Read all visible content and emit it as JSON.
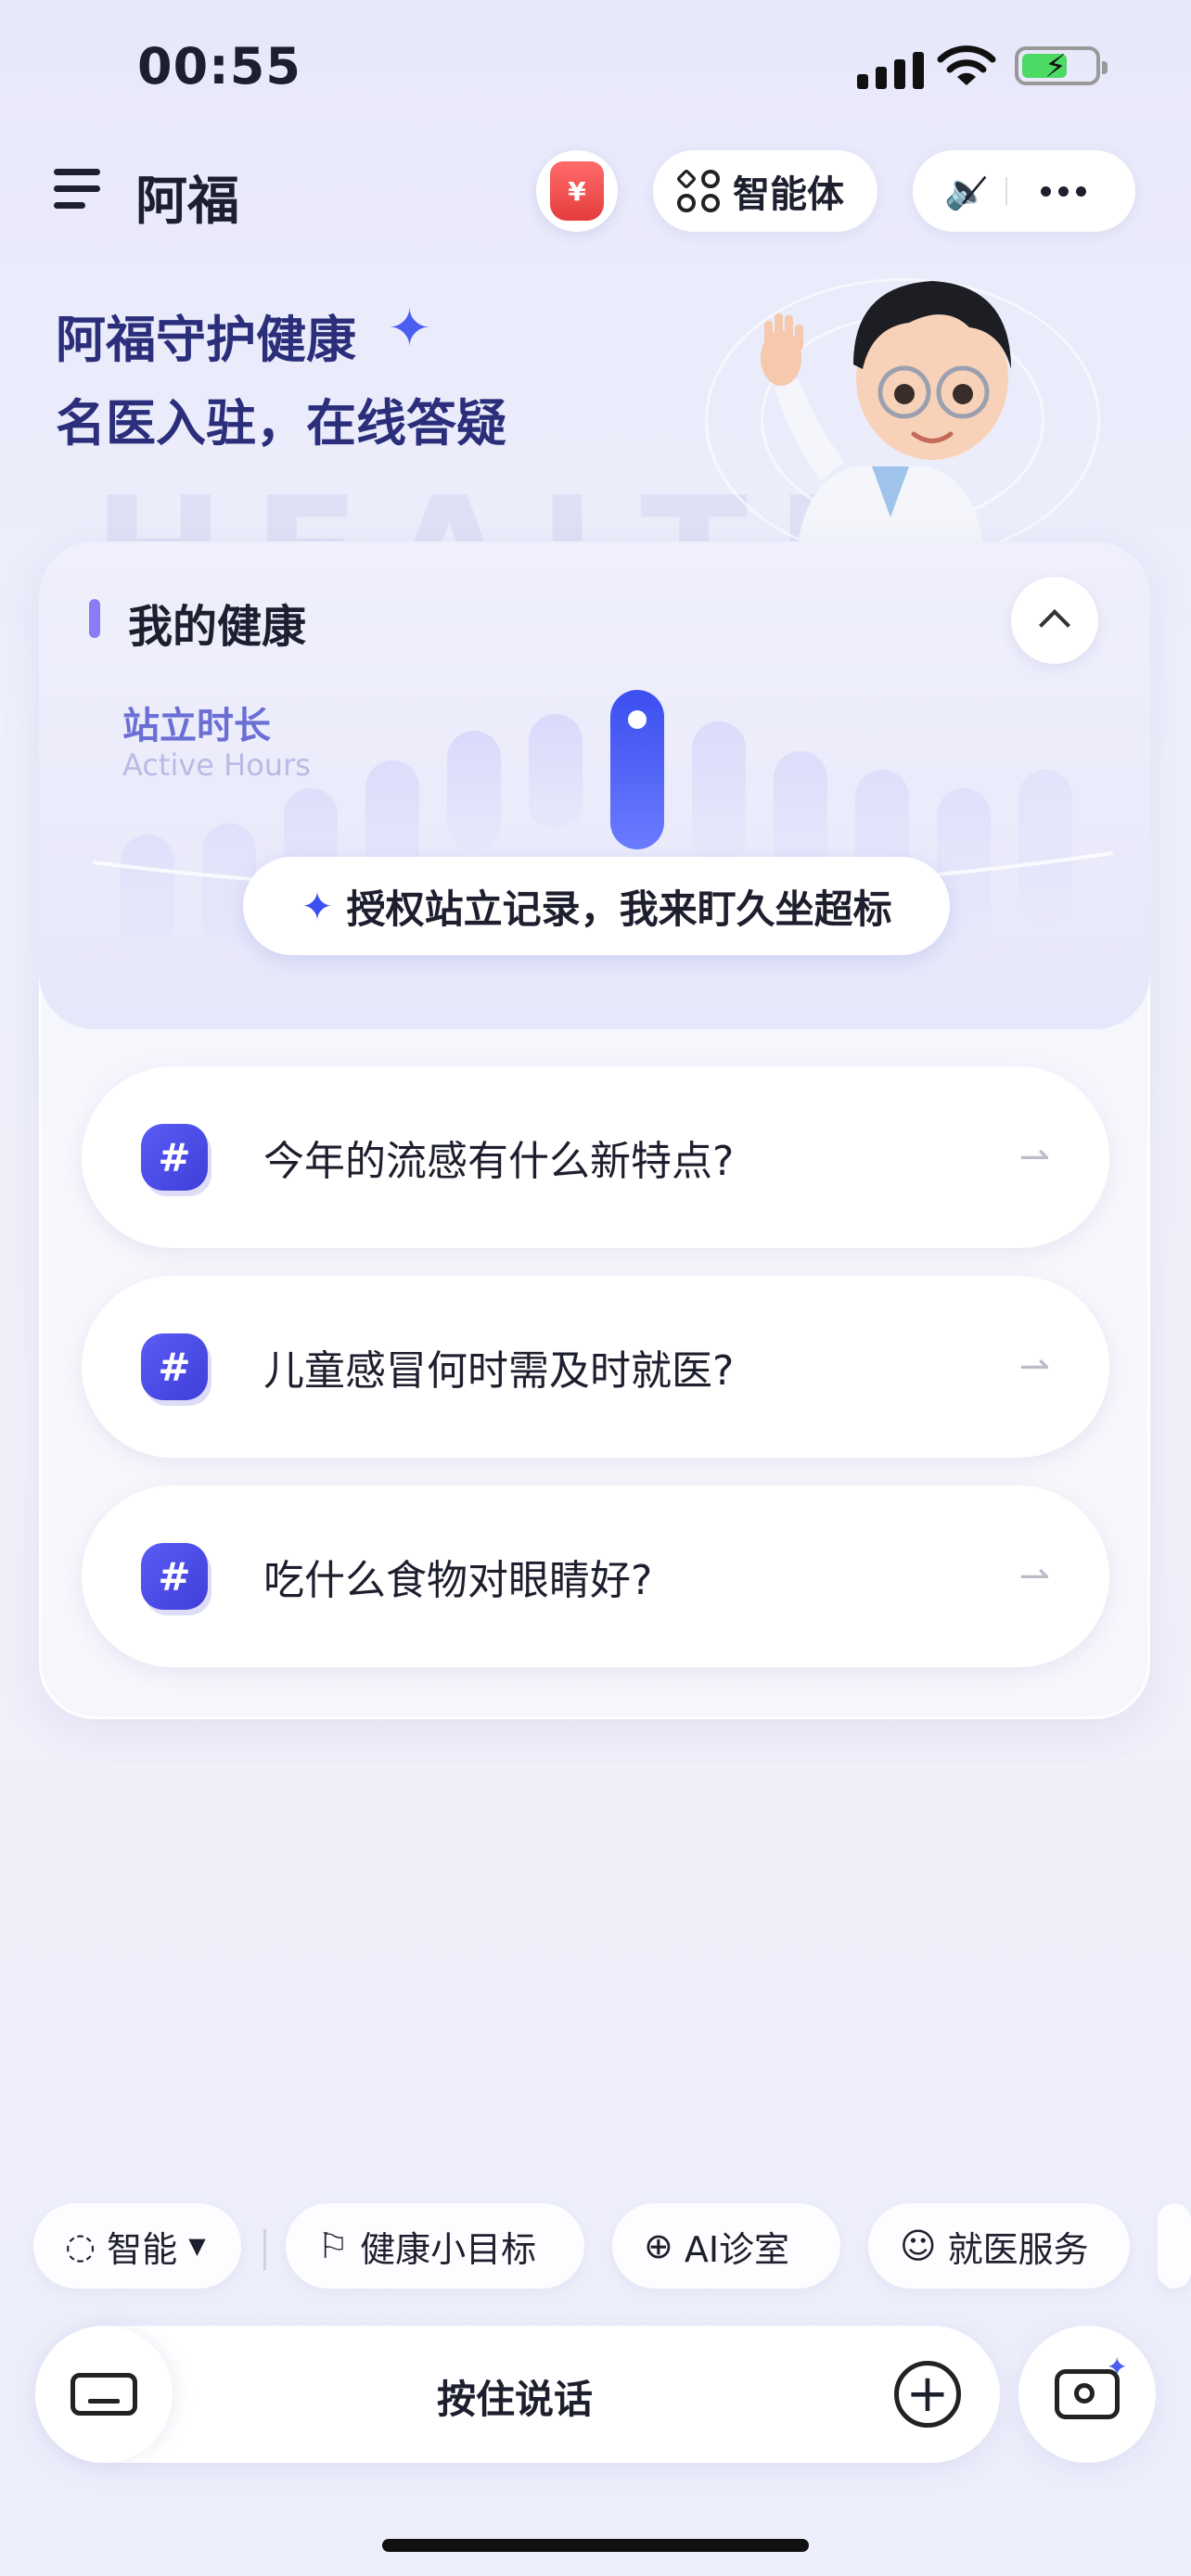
{
  "status_bar": {
    "time": "00:55"
  },
  "header": {
    "title": "阿福",
    "coin_symbol": "¥",
    "agent_label": "智能体"
  },
  "hero": {
    "line1": "阿福守护健康",
    "line2": "名医入驻，在线答疑",
    "watermark": "HEALTH"
  },
  "health_card": {
    "title": "我的健康",
    "metric_label": "站立时长",
    "metric_sub": "Active Hours",
    "tip": "授权站立记录，我来盯久坐超标"
  },
  "questions": [
    {
      "text": "今年的流感有什么新特点?"
    },
    {
      "text": "儿童感冒何时需及时就医?"
    },
    {
      "text": "吃什么食物对眼睛好?"
    }
  ],
  "chips": {
    "mode_label": "智能",
    "goal_label": "健康小目标",
    "ai_clinic_label": "AI诊室",
    "medical_label": "就医服务"
  },
  "input_bar": {
    "label": "按住说话"
  },
  "colors": {
    "accent": "#4a5ef0",
    "title": "#2b2e7a"
  }
}
